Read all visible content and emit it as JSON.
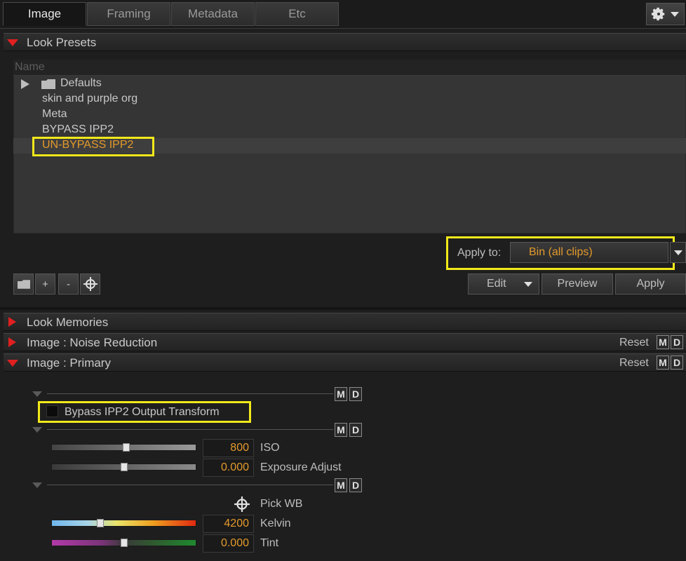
{
  "tabs": [
    "Image",
    "Framing",
    "Metadata",
    "Etc"
  ],
  "sections": {
    "look_presets": "Look Presets",
    "look_memories": "Look Memories",
    "noise_reduction": "Image : Noise Reduction",
    "primary": "Image : Primary"
  },
  "reset_label": "Reset",
  "md": {
    "m": "M",
    "d": "D"
  },
  "presets": {
    "column_header": "Name",
    "folder": "Defaults",
    "items": [
      "skin and purple org",
      "Meta",
      "BYPASS IPP2",
      "UN-BYPASS IPP2"
    ],
    "selected": "UN-BYPASS IPP2"
  },
  "apply_to": {
    "label": "Apply to:",
    "value": "Bin (all clips)"
  },
  "small_buttons": {
    "plus": "+",
    "minus": "-"
  },
  "actions": {
    "edit": "Edit",
    "preview": "Preview",
    "apply": "Apply"
  },
  "primary": {
    "bypass_label": "Bypass IPP2 Output Transform",
    "bypass_checked": false,
    "iso": {
      "label": "ISO",
      "value": "800",
      "slider_fraction": 0.52
    },
    "exposure": {
      "label": "Exposure Adjust",
      "value": "0.000",
      "slider_fraction": 0.5
    },
    "pick_wb": "Pick WB",
    "kelvin": {
      "label": "Kelvin",
      "value": "4200",
      "slider_fraction": 0.33
    },
    "tint": {
      "label": "Tint",
      "value": "0.000",
      "slider_fraction": 0.5
    }
  },
  "colors": {
    "accent_orange": "#e39a2c",
    "highlight_yellow": "#f2e81a",
    "arrow_red": "#e02020"
  }
}
